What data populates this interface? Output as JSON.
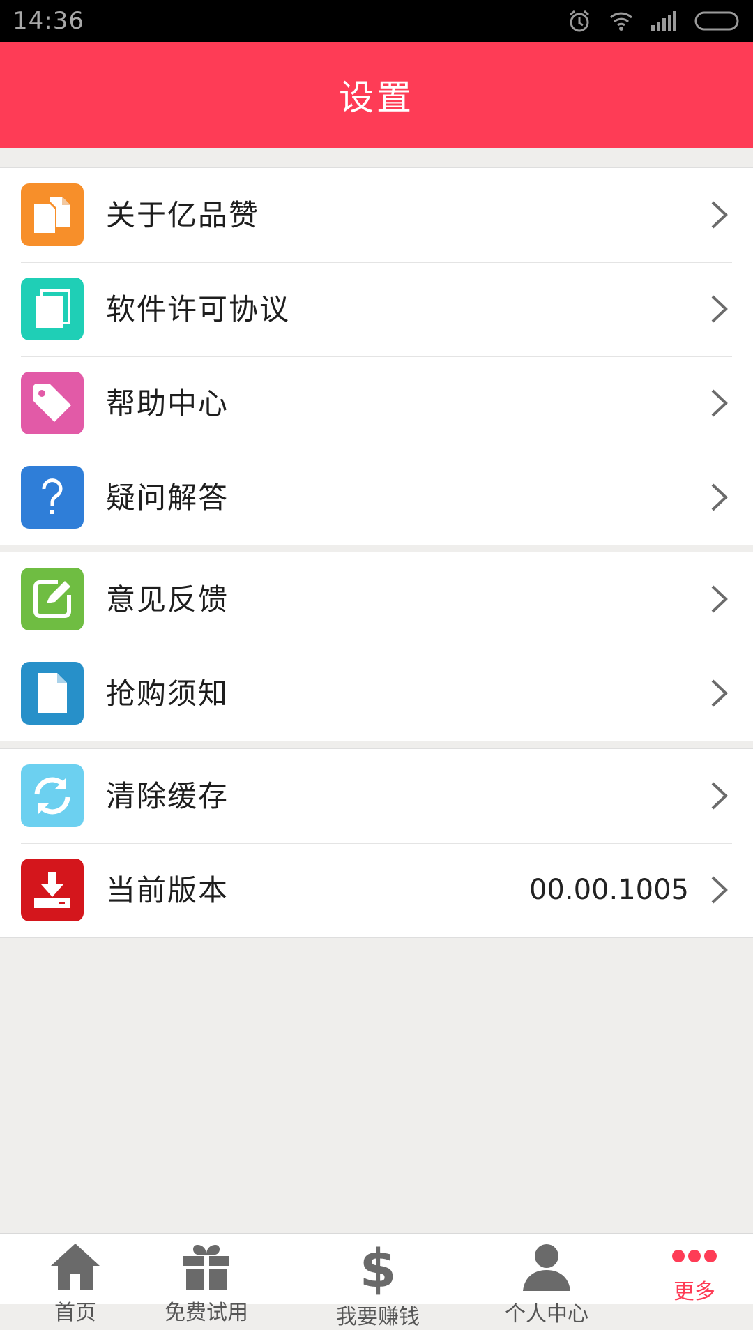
{
  "status_bar": {
    "time": "14:36",
    "icons": [
      "alarm-icon",
      "wifi-icon",
      "signal-icon",
      "battery-icon"
    ]
  },
  "header": {
    "title": "设置"
  },
  "groups": [
    {
      "items": [
        {
          "label": "关于亿品赞",
          "icon": "document-copy-icon",
          "icon_color": "#f78f2a"
        },
        {
          "label": "软件许可协议",
          "icon": "book-icon",
          "icon_color": "#1fcfb6"
        },
        {
          "label": "帮助中心",
          "icon": "tag-icon",
          "icon_color": "#e25aa7"
        },
        {
          "label": "疑问解答",
          "icon": "question-icon",
          "icon_color": "#2f7ed8"
        }
      ]
    },
    {
      "items": [
        {
          "label": "意见反馈",
          "icon": "edit-icon",
          "icon_color": "#6fbd42"
        },
        {
          "label": "抢购须知",
          "icon": "file-icon",
          "icon_color": "#2790c9"
        }
      ]
    },
    {
      "items": [
        {
          "label": "清除缓存",
          "icon": "refresh-icon",
          "icon_color": "#6cd0f0"
        },
        {
          "label": "当前版本",
          "icon": "download-icon",
          "icon_color": "#d4161c",
          "value": "00.00.1005"
        }
      ]
    }
  ],
  "tab_bar": {
    "tabs": [
      {
        "label": "首页",
        "icon": "home-icon",
        "active": false
      },
      {
        "label": "免费试用",
        "icon": "gift-icon",
        "active": false
      },
      {
        "label": "我要赚钱",
        "icon": "dollar-icon",
        "active": false
      },
      {
        "label": "个人中心",
        "icon": "person-icon",
        "active": false
      },
      {
        "label": "更多",
        "icon": "more-icon",
        "active": true
      }
    ]
  },
  "colors": {
    "accent": "#fe3c56",
    "background": "#efeeec",
    "tab_inactive": "#555555"
  }
}
